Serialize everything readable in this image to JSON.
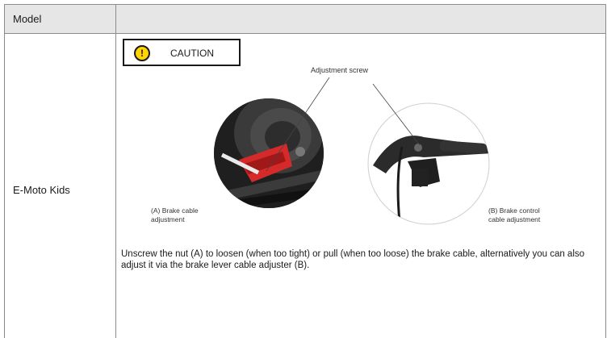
{
  "table": {
    "header_label": "Model",
    "model_name": "E-Moto Kids"
  },
  "caution": {
    "icon": "exclamation-warning-icon",
    "icon_color": "#ffd400",
    "mark": "!",
    "label": "CAUTION"
  },
  "figure": {
    "label_screw": "Adjustment screw",
    "label_a_line1": "(A) Brake cable",
    "label_a_line2": "adjustment",
    "label_b_line1": "(B) Brake control",
    "label_b_line2": "cable adjustment"
  },
  "instructions": "Unscrew the nut (A) to loosen (when too tight) or pull (when too loose) the brake cable, alternatively you can also adjust it via the brake lever cable adjuster (B)."
}
